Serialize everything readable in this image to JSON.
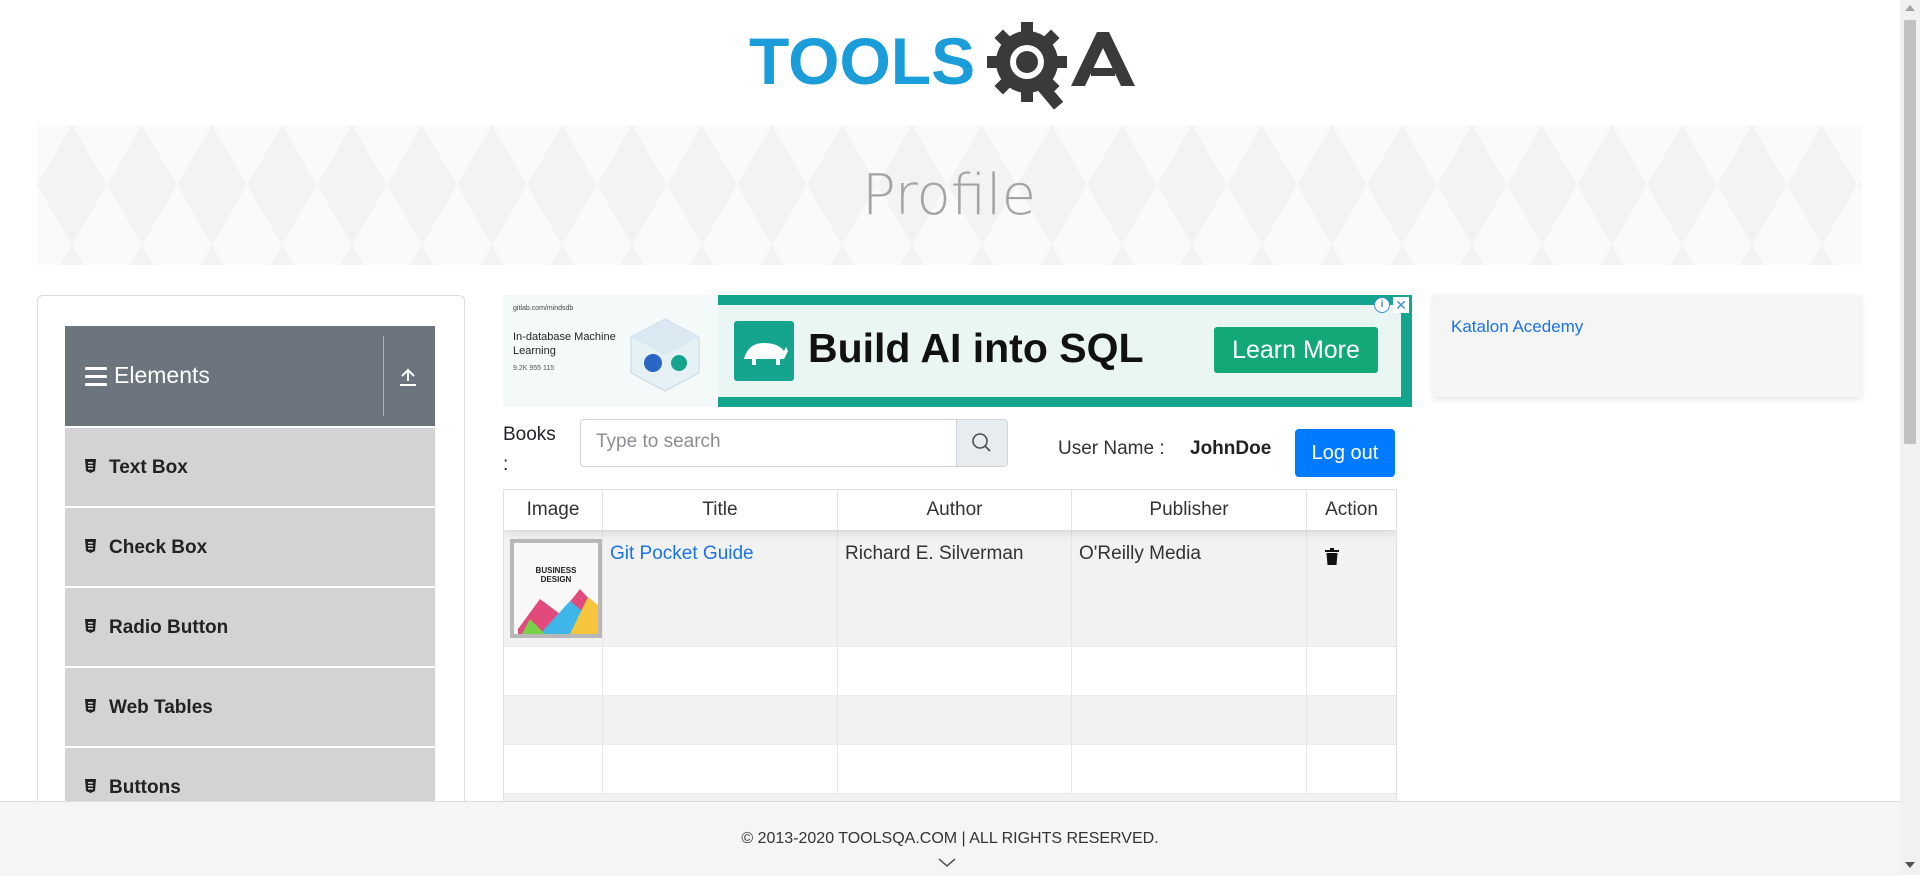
{
  "brand": {
    "logo_text": "TOOLSQA",
    "logo_blue": "#1a9dd8",
    "logo_dark": "#3a3a3a"
  },
  "page_title": "Profile",
  "sidebar": {
    "header_label": "Elements",
    "items": [
      {
        "label": "Text Box"
      },
      {
        "label": "Check Box"
      },
      {
        "label": "Radio Button"
      },
      {
        "label": "Web Tables"
      },
      {
        "label": "Buttons"
      }
    ]
  },
  "ad": {
    "small_text": "gitlab.com/mindsdb",
    "left_headline": "In-database Machine Learning",
    "stats": "9.2K  955  115",
    "headline": "Build AI into SQL",
    "cta": "Learn More"
  },
  "side_ad": {
    "image_alt": "Katalon Acedemy"
  },
  "books": {
    "label": "Books :",
    "search_placeholder": "Type to search"
  },
  "user": {
    "name_label": "User Name :",
    "name_value": "JohnDoe",
    "logout": "Log out"
  },
  "table": {
    "headers": [
      "Image",
      "Title",
      "Author",
      "Publisher",
      "Action"
    ],
    "rows": [
      {
        "title": "Git Pocket Guide",
        "author": "Richard E. Silverman",
        "publisher": "O'Reilly Media",
        "cover_text": "BUSINESS DESIGN"
      }
    ]
  },
  "footer": {
    "text": "© 2013-2020 TOOLSQA.COM | ALL RIGHTS RESERVED."
  },
  "colors": {
    "primary": "#007bff",
    "sidebar_header": "#6c757d",
    "ad_green": "#15a58f"
  }
}
